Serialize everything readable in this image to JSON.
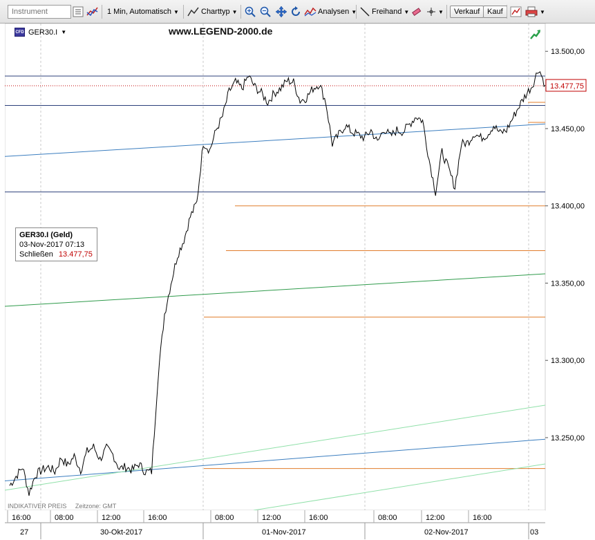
{
  "toolbar": {
    "instrument_placeholder": "Instrument",
    "interval_label": "1 Min,  Automatisch",
    "charttype_label": "Charttyp",
    "analyses_label": "Analysen",
    "freehand_label": "Freihand",
    "sell_label": "Verkauf",
    "buy_label": "Kauf"
  },
  "chart": {
    "symbol": "GER30.I",
    "watermark": "www.LEGEND-2000.de",
    "last_price_tag": "13.477,75",
    "indicative_label": "INDIKATIVER PREIS",
    "timezone_label": "Zeitzone: GMT",
    "info_box": {
      "title": "GER30.I (Geld)",
      "timestamp": "03-Nov-2017 07:13",
      "close_label": "Schließen",
      "close_value": "13.477,75"
    },
    "y_axis_labels": [
      "13.500,00",
      "13.450,00",
      "13.400,00",
      "13.350,00",
      "13.300,00",
      "13.250,00"
    ],
    "x_axis_time_labels": [
      "16:00",
      "08:00",
      "12:00",
      "16:00",
      "08:00",
      "12:00",
      "16:00",
      "08:00",
      "12:00",
      "16:00"
    ],
    "x_axis_date_labels": [
      "27",
      "30-Okt-2017",
      "01-Nov-2017",
      "02-Nov-2017",
      "03"
    ],
    "colors": {
      "price_line": "#000000",
      "horizontal_line": "#2b3f7a",
      "fib_line": "#e07b2a",
      "trend_blue": "#3a7dbf",
      "trend_green": "#2e9a4a",
      "trend_lightgreen": "#8fe0a8",
      "last_price_dotted": "#c00000"
    }
  },
  "chart_data": {
    "type": "line",
    "series": [
      {
        "values": [
          13219,
          13225,
          13231,
          13214,
          13226,
          13229,
          13231,
          13228,
          13237,
          13232,
          13238,
          13229,
          13241,
          13244,
          13236,
          13243,
          13239,
          13230,
          13231,
          13229,
          13233,
          13228,
          13228,
          13290,
          13330,
          13350,
          13368,
          13378,
          13393,
          13402,
          13441,
          13436,
          13449,
          13458,
          13474,
          13480,
          13476,
          13484,
          13477,
          13473,
          13467,
          13473,
          13476,
          13481,
          13480,
          13468,
          13470,
          13476,
          13479,
          13467,
          13440,
          13446,
          13452,
          13448,
          13446,
          13444,
          13449,
          13441,
          13450,
          13445,
          13449,
          13448,
          13453,
          13458,
          13455,
          13430,
          13409,
          13435,
          13424,
          13412,
          13440,
          13441,
          13447,
          13444,
          13446,
          13452,
          13447,
          13449,
          13457,
          13465,
          13472,
          13478,
          13489,
          13478
        ]
      }
    ],
    "ylim": [
      13203,
      13518
    ],
    "horizontal_levels": [
      13484,
      13465,
      13409
    ],
    "orange_levels": [
      13467,
      13454,
      13400,
      13371,
      13328,
      13230
    ],
    "last_price": 13477.75
  }
}
